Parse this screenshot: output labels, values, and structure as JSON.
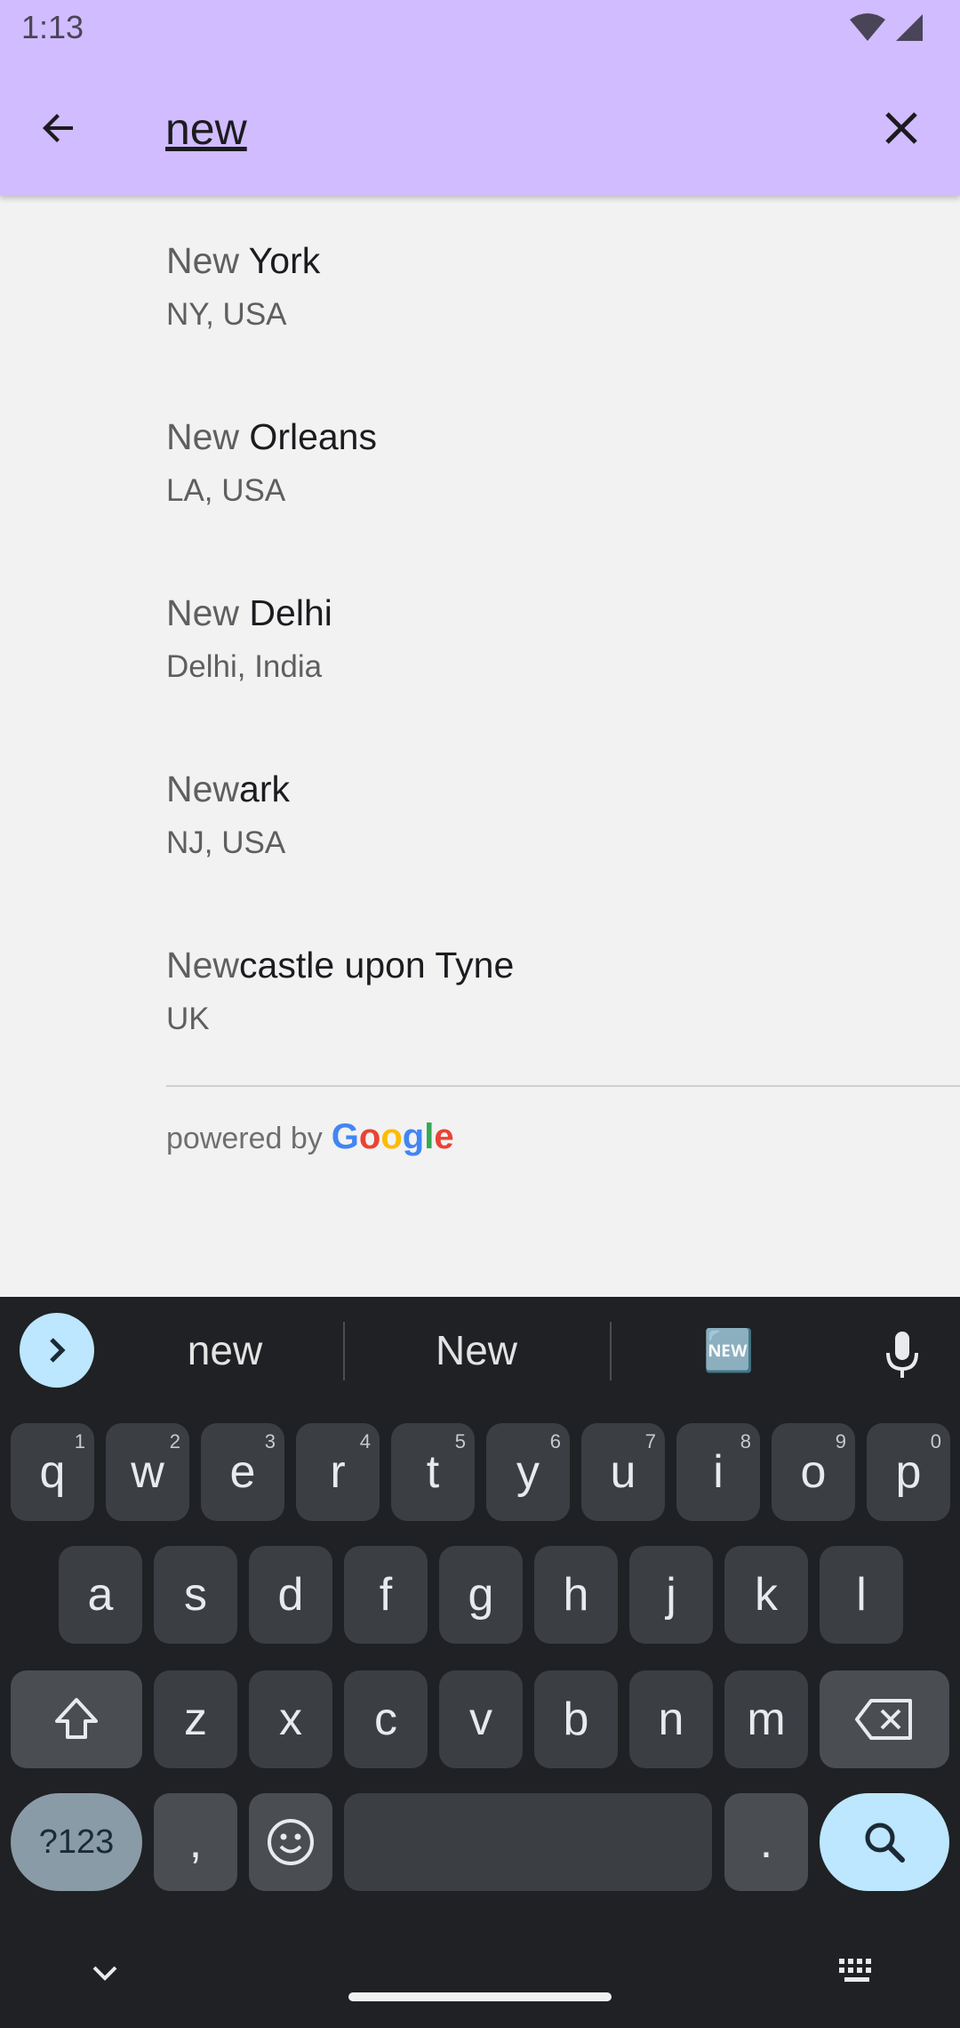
{
  "status": {
    "time": "1:13"
  },
  "search": {
    "value": "new",
    "placeholder": ""
  },
  "results": [
    {
      "match": "New",
      "rest": " York",
      "secondary": "NY, USA"
    },
    {
      "match": "New",
      "rest": " Orleans",
      "secondary": "LA, USA"
    },
    {
      "match": "New",
      "rest": " Delhi",
      "secondary": "Delhi, India"
    },
    {
      "match": "New",
      "rest": "ark",
      "secondary": "NJ, USA"
    },
    {
      "match": "New",
      "rest": "castle upon Tyne",
      "secondary": "UK"
    }
  ],
  "attribution": {
    "prefix": "powered by",
    "logo_letters": [
      "G",
      "o",
      "o",
      "g",
      "l",
      "e"
    ]
  },
  "keyboard": {
    "suggestions": [
      "new",
      "New",
      "🆕"
    ],
    "row1": [
      {
        "k": "q",
        "h": "1"
      },
      {
        "k": "w",
        "h": "2"
      },
      {
        "k": "e",
        "h": "3"
      },
      {
        "k": "r",
        "h": "4"
      },
      {
        "k": "t",
        "h": "5"
      },
      {
        "k": "y",
        "h": "6"
      },
      {
        "k": "u",
        "h": "7"
      },
      {
        "k": "i",
        "h": "8"
      },
      {
        "k": "o",
        "h": "9"
      },
      {
        "k": "p",
        "h": "0"
      }
    ],
    "row2": [
      "a",
      "s",
      "d",
      "f",
      "g",
      "h",
      "j",
      "k",
      "l"
    ],
    "row3": [
      "z",
      "x",
      "c",
      "v",
      "b",
      "n",
      "m"
    ],
    "sym_label": "?123",
    "comma": ",",
    "period": "."
  },
  "colors": {
    "app_bar": "#d0bcff",
    "background": "#f2f2f2",
    "keyboard": "#1f2124",
    "accent": "#bde6ff"
  }
}
